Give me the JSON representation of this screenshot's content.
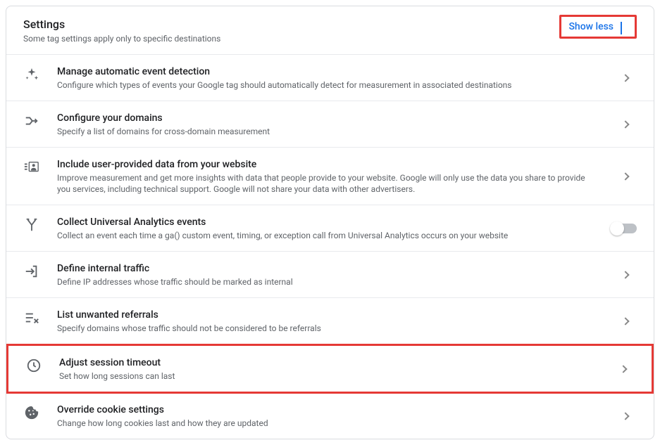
{
  "header": {
    "title": "Settings",
    "subtitle": "Some tag settings apply only to specific destinations",
    "toggle_label": "Show less"
  },
  "rows": [
    {
      "title": "Manage automatic event detection",
      "desc": "Configure which types of events your Google tag should automatically detect for measurement in associated destinations",
      "action": "chevron"
    },
    {
      "title": "Configure your domains",
      "desc": "Specify a list of domains for cross-domain measurement",
      "action": "chevron"
    },
    {
      "title": "Include user-provided data from your website",
      "desc": "Improve measurement and get more insights with data that people provide to your website. Google will only use the data you share to provide you services, including technical support. Google will not share your data with other advertisers.",
      "action": "chevron"
    },
    {
      "title": "Collect Universal Analytics events",
      "desc": "Collect an event each time a ga() custom event, timing, or exception call from Universal Analytics occurs on your website",
      "action": "toggle"
    },
    {
      "title": "Define internal traffic",
      "desc": "Define IP addresses whose traffic should be marked as internal",
      "action": "chevron"
    },
    {
      "title": "List unwanted referrals",
      "desc": "Specify domains whose traffic should not be considered to be referrals",
      "action": "chevron"
    },
    {
      "title": "Adjust session timeout",
      "desc": "Set how long sessions can last",
      "action": "chevron",
      "highlight": true
    },
    {
      "title": "Override cookie settings",
      "desc": "Change how long cookies last and how they are updated",
      "action": "chevron"
    }
  ]
}
